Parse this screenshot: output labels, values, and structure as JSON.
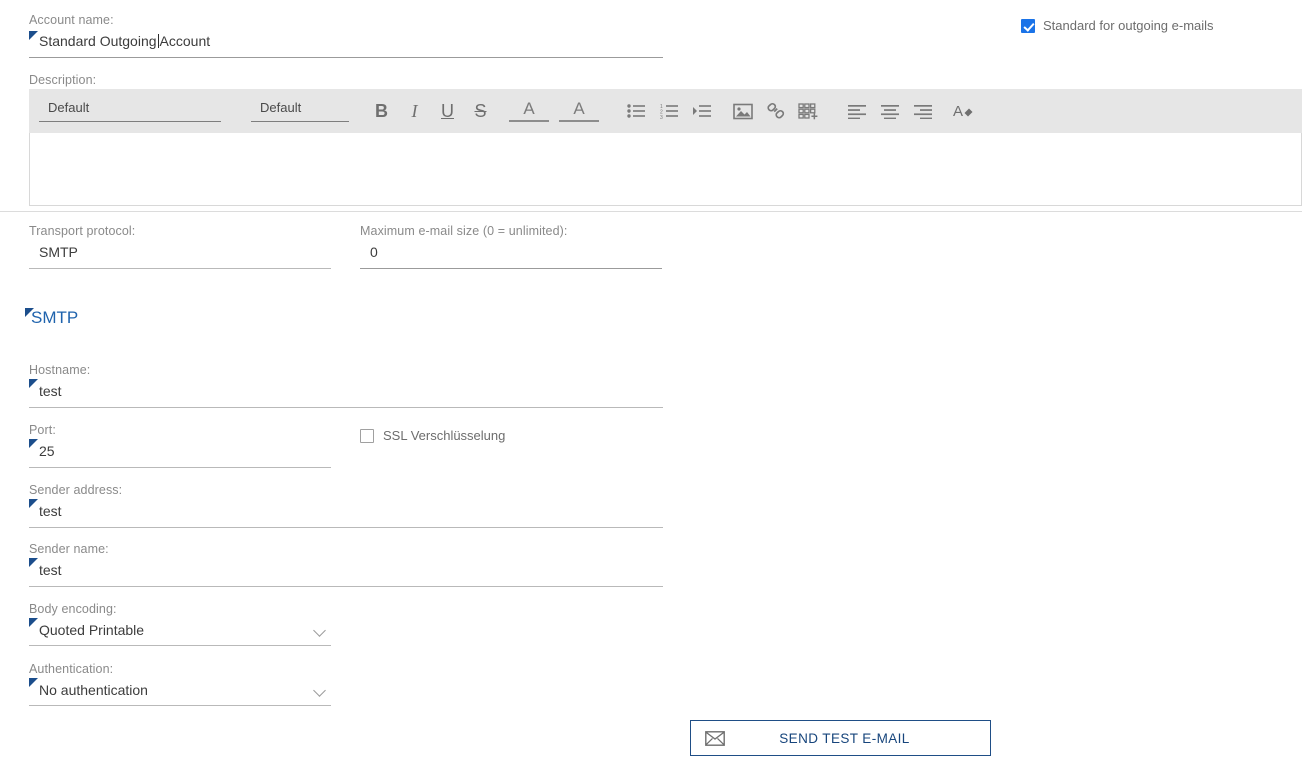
{
  "account_name": {
    "label": "Account name:",
    "value_before_caret": "Standard Outgoing",
    "value_after_caret": "Account",
    "full_value": "Standard Outgoing Account"
  },
  "standard_outgoing": {
    "label": "Standard for outgoing e-mails",
    "checked": true
  },
  "description": {
    "label": "Description:",
    "body_value": "",
    "toolbar": {
      "font_family": "Default",
      "font_size": "Default",
      "buttons": [
        {
          "name": "bold-icon",
          "glyph": "B"
        },
        {
          "name": "italic-icon",
          "glyph": "I"
        },
        {
          "name": "underline-icon",
          "glyph": "U"
        },
        {
          "name": "strikethrough-icon",
          "glyph": "S"
        },
        {
          "name": "highlight-color-icon",
          "glyph": "A"
        },
        {
          "name": "text-color-icon",
          "glyph": "A"
        },
        {
          "name": "bullet-list-icon",
          "glyph": ""
        },
        {
          "name": "numbered-list-icon",
          "glyph": ""
        },
        {
          "name": "indent-icon",
          "glyph": ""
        },
        {
          "name": "insert-image-icon",
          "glyph": ""
        },
        {
          "name": "insert-link-icon",
          "glyph": ""
        },
        {
          "name": "insert-table-icon",
          "glyph": ""
        },
        {
          "name": "align-left-icon",
          "glyph": ""
        },
        {
          "name": "align-center-icon",
          "glyph": ""
        },
        {
          "name": "align-right-icon",
          "glyph": ""
        },
        {
          "name": "clear-formatting-icon",
          "glyph": ""
        }
      ]
    }
  },
  "transport_protocol": {
    "label": "Transport protocol:",
    "value": "SMTP"
  },
  "max_email_size": {
    "label": "Maximum e-mail size (0 = unlimited):",
    "value": "0"
  },
  "smtp_section": {
    "title": "SMTP"
  },
  "hostname": {
    "label": "Hostname:",
    "value": "test"
  },
  "port": {
    "label": "Port:",
    "value": "25"
  },
  "ssl": {
    "label": "SSL Verschlüsselung",
    "checked": false
  },
  "sender_address": {
    "label": "Sender address:",
    "value": "test"
  },
  "sender_name": {
    "label": "Sender name:",
    "value": "test"
  },
  "body_encoding": {
    "label": "Body encoding:",
    "value": "Quoted Printable"
  },
  "authentication": {
    "label": "Authentication:",
    "value": "No authentication"
  },
  "send_test_button": {
    "label": "SEND TEST E-MAIL",
    "icon": "envelope-icon"
  },
  "colors": {
    "accent_blue": "#1f63ad",
    "marker_blue": "#1c4e8c",
    "checkbox_blue": "#1a73e8",
    "button_border": "#1f4e86",
    "button_text": "#17457c",
    "toolbar_bg": "#e6e6e6",
    "label_gray": "#8a8a8a",
    "value_gray": "#3c3c3c"
  }
}
